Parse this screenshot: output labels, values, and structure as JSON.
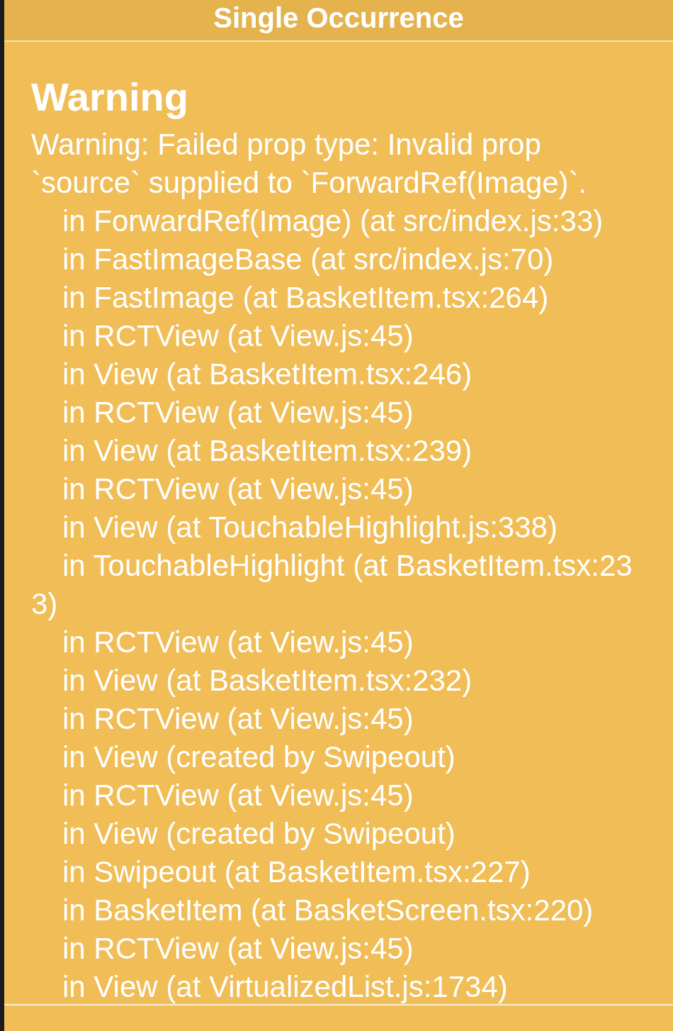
{
  "header": {
    "title": "Single Occurrence"
  },
  "warning": {
    "title": "Warning",
    "message": "Warning: Failed prop type: Invalid prop `source` supplied to `ForwardRef(Image)`.",
    "stack": [
      "in ForwardRef(Image) (at src/index.js:33)",
      "in FastImageBase (at src/index.js:70)",
      "in FastImage (at BasketItem.tsx:264)",
      "in RCTView (at View.js:45)",
      "in View (at BasketItem.tsx:246)",
      "in RCTView (at View.js:45)",
      "in View (at BasketItem.tsx:239)",
      "in RCTView (at View.js:45)",
      "in View (at TouchableHighlight.js:338)",
      "in TouchableHighlight (at BasketItem.tsx:233)",
      "in RCTView (at View.js:45)",
      "in View (at BasketItem.tsx:232)",
      "in RCTView (at View.js:45)",
      "in View (created by Swipeout)",
      "in RCTView (at View.js:45)",
      "in View (created by Swipeout)",
      "in Swipeout (at BasketItem.tsx:227)",
      "in BasketItem (at BasketScreen.tsx:220)",
      "in RCTView (at View.js:45)",
      "in View (at VirtualizedList.js:1734)"
    ]
  }
}
